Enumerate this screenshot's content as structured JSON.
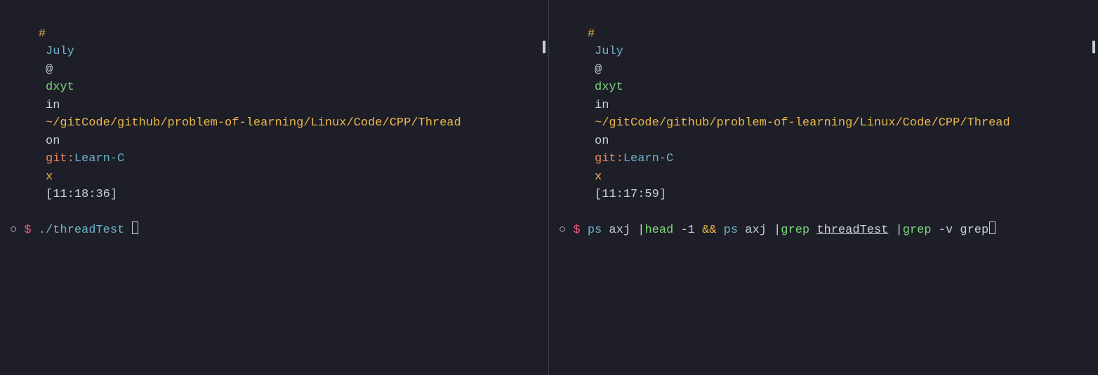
{
  "left": {
    "prompt": {
      "hash": "#",
      "user": "July",
      "at": "@",
      "host": "dxyt",
      "in": "in",
      "path": "~/gitCode/github/problem-of-learning/Linux/Code/CPP/Thread",
      "on": "on",
      "git": "git:",
      "branch": "Learn-C",
      "x": "x",
      "time": "[11:18:36]"
    },
    "cmd": {
      "circle": "○",
      "dollar": "$",
      "command": "./threadTest"
    }
  },
  "right": {
    "prompt": {
      "hash": "#",
      "user": "July",
      "at": "@",
      "host": "dxyt",
      "in": "in",
      "path": "~/gitCode/github/problem-of-learning/Linux/Code/CPP/Thread",
      "on": "on",
      "git": "git:",
      "branch": "Learn-C",
      "x": "x",
      "time": "[11:17:59]"
    },
    "cmd": {
      "circle": "○",
      "dollar": "$",
      "ps1": "ps",
      "axj1": "axj",
      "pipe1": "|",
      "head": "head",
      "neg1": "-1",
      "andand": "&&",
      "ps2": "ps",
      "axj2": "axj",
      "pipe2": "|",
      "grep1": "grep",
      "thread": "threadTest",
      "pipe3": "|",
      "grep2": "grep",
      "vflag": "-v",
      "greparg": "grep"
    }
  }
}
